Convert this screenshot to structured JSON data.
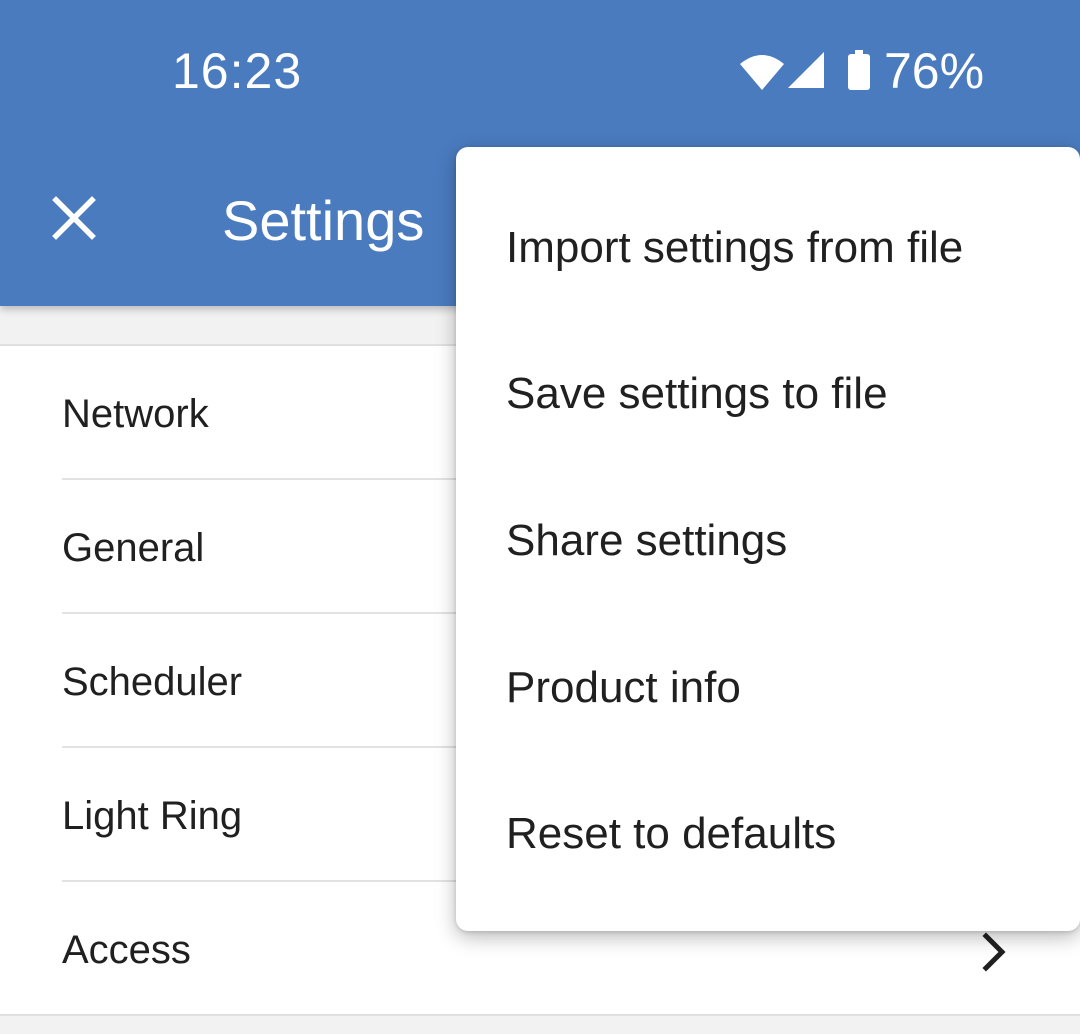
{
  "status_bar": {
    "time": "16:23",
    "battery_percent": "76%",
    "icons": [
      "wifi-icon",
      "signal-icon",
      "battery-icon"
    ]
  },
  "app_bar": {
    "title": "Settings",
    "close_icon": "close-icon"
  },
  "settings_list": {
    "items": [
      {
        "label": "Network"
      },
      {
        "label": "General"
      },
      {
        "label": "Scheduler"
      },
      {
        "label": "Light Ring"
      },
      {
        "label": "Access"
      }
    ]
  },
  "overflow_menu": {
    "items": [
      {
        "label": "Import settings from file"
      },
      {
        "label": "Save settings to file"
      },
      {
        "label": "Share settings"
      },
      {
        "label": "Product info"
      },
      {
        "label": "Reset to defaults"
      }
    ]
  },
  "colors": {
    "primary": "#4a7bbf",
    "surface": "#ffffff",
    "background": "#f2f2f2",
    "text": "#202020"
  }
}
